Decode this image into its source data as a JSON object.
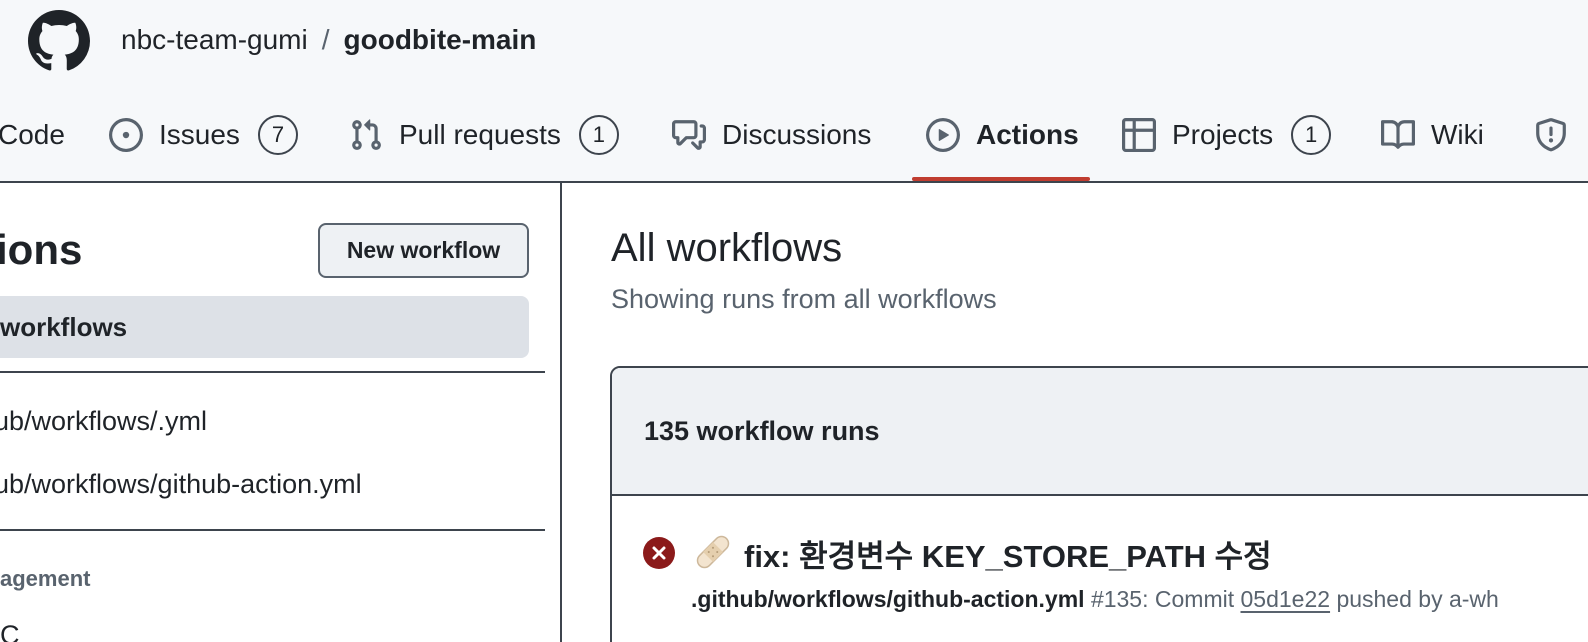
{
  "header": {
    "owner": "nbc-team-gumi",
    "separator": "/",
    "repo": "goodbite-main",
    "logo_icon": "github-octocat-icon"
  },
  "nav": {
    "tabs": [
      {
        "label": "Code",
        "icon": "code-icon"
      },
      {
        "label": "Issues",
        "icon": "issue-opened-icon",
        "count": "7"
      },
      {
        "label": "Pull requests",
        "icon": "git-pull-request-icon",
        "count": "1"
      },
      {
        "label": "Discussions",
        "icon": "comment-discussion-icon"
      },
      {
        "label": "Actions",
        "icon": "play-icon",
        "active": true
      },
      {
        "label": "Projects",
        "icon": "table-icon",
        "count": "1"
      },
      {
        "label": "Wiki",
        "icon": "book-icon"
      },
      {
        "label": "",
        "icon": "shield-icon"
      }
    ],
    "active_underline_color": "#c03d30"
  },
  "sidebar": {
    "title": "ions",
    "new_workflow_label": "New workflow",
    "all_workflows_label": "workflows",
    "workflows": [
      "ub/workflows/.yml",
      "ub/workflows/github-action.yml"
    ],
    "section_label": "agement",
    "partial_item": "C"
  },
  "main": {
    "title": "All workflows",
    "subtitle": "Showing runs from all workflows",
    "runs_count": "135 workflow runs",
    "runs": [
      {
        "status": "failure",
        "status_color": "#8b1a1a",
        "emoji_icon": "adhesive-bandage-icon",
        "title": "fix: 환경변수 KEY_STORE_PATH 수정",
        "workflow_file": ".github/workflows/github-action.yml",
        "run_number": "#135: Commit",
        "commit": "05d1e22",
        "pushed_by": "pushed by a-wh"
      }
    ]
  }
}
